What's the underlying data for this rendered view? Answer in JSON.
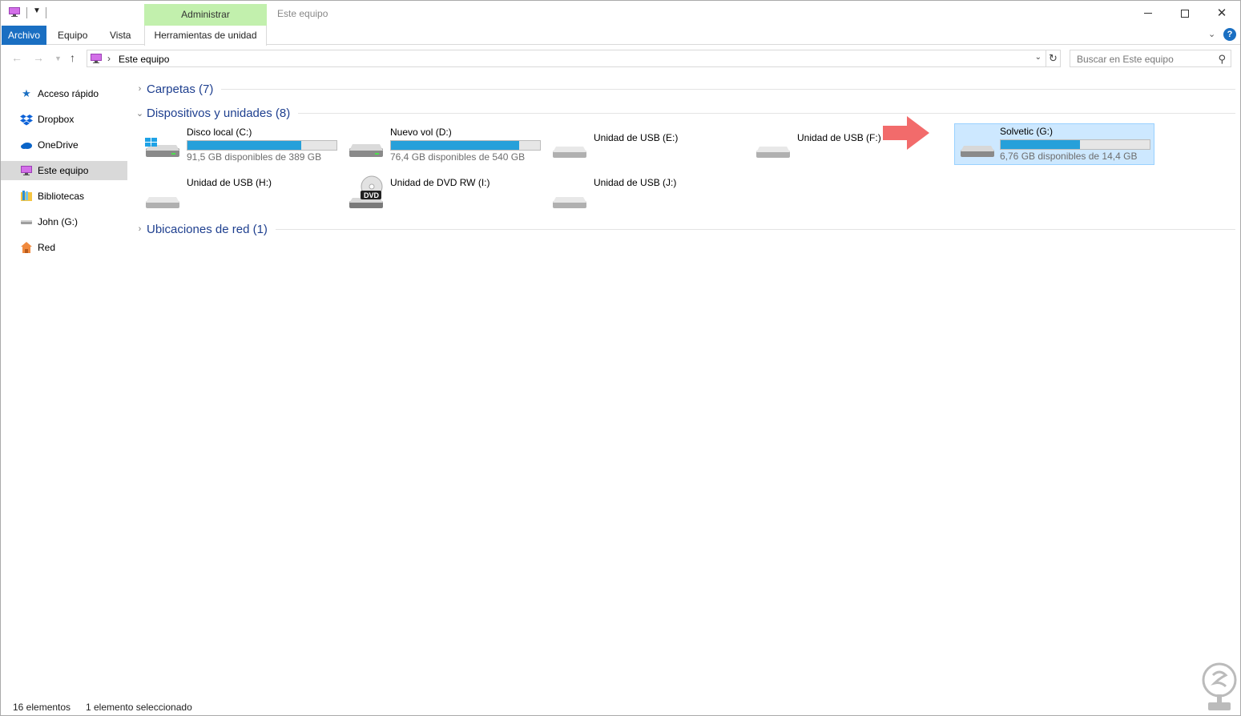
{
  "window": {
    "title": "Este equipo",
    "context_tab": "Administrar",
    "controls": {
      "minimize": "minimize-icon",
      "maximize": "maximize-icon",
      "close": "✕"
    }
  },
  "ribbon": {
    "tabs": [
      "Archivo",
      "Equipo",
      "Vista",
      "Herramientas de unidad"
    ],
    "help": "?"
  },
  "address": {
    "path": "Este equipo",
    "search_placeholder": "Buscar en Este equipo"
  },
  "sidebar": {
    "items": [
      {
        "label": "Acceso rápido",
        "icon": "star-icon"
      },
      {
        "label": "Dropbox",
        "icon": "dropbox-icon"
      },
      {
        "label": "OneDrive",
        "icon": "cloud-icon"
      },
      {
        "label": "Este equipo",
        "icon": "computer-icon",
        "active": true
      },
      {
        "label": "Bibliotecas",
        "icon": "library-icon"
      },
      {
        "label": "John (G:)",
        "icon": "usb-drive-icon"
      },
      {
        "label": "Red",
        "icon": "network-icon"
      }
    ]
  },
  "groups": {
    "folders": "Carpetas (7)",
    "devices": "Dispositivos y unidades (8)",
    "network": "Ubicaciones de red (1)"
  },
  "drives": [
    {
      "name": "Disco local (C:)",
      "free": "91,5 GB disponibles de 389 GB",
      "used_fraction": 0.765,
      "icon": "windows-drive-icon"
    },
    {
      "name": "Nuevo vol (D:)",
      "free": "76,4 GB disponibles de 540 GB",
      "used_fraction": 0.858,
      "icon": "hard-drive-icon"
    },
    {
      "name": "Unidad de USB (E:)",
      "icon": "usb-drive-icon"
    },
    {
      "name": "Unidad de USB (F:)",
      "icon": "usb-drive-icon"
    },
    {
      "name": "Solvetic (G:)",
      "free": "6,76 GB disponibles de 14,4 GB",
      "used_fraction": 0.53,
      "icon": "usb-drive-icon",
      "selected": true
    },
    {
      "name": "Unidad de USB (H:)",
      "icon": "usb-drive-icon"
    },
    {
      "name": "Unidad de DVD RW (I:)",
      "icon": "dvd-drive-icon",
      "badge": "DVD"
    },
    {
      "name": "Unidad de USB (J:)",
      "icon": "usb-drive-icon"
    }
  ],
  "status": {
    "count": "16 elementos",
    "selection": "1 elemento seleccionado"
  },
  "colors": {
    "accent": "#1a6fc2",
    "selection": "#cde8ff",
    "bar": "#26a0da",
    "context_tab": "#c2f0ad",
    "arrow": "#f26b6b"
  }
}
